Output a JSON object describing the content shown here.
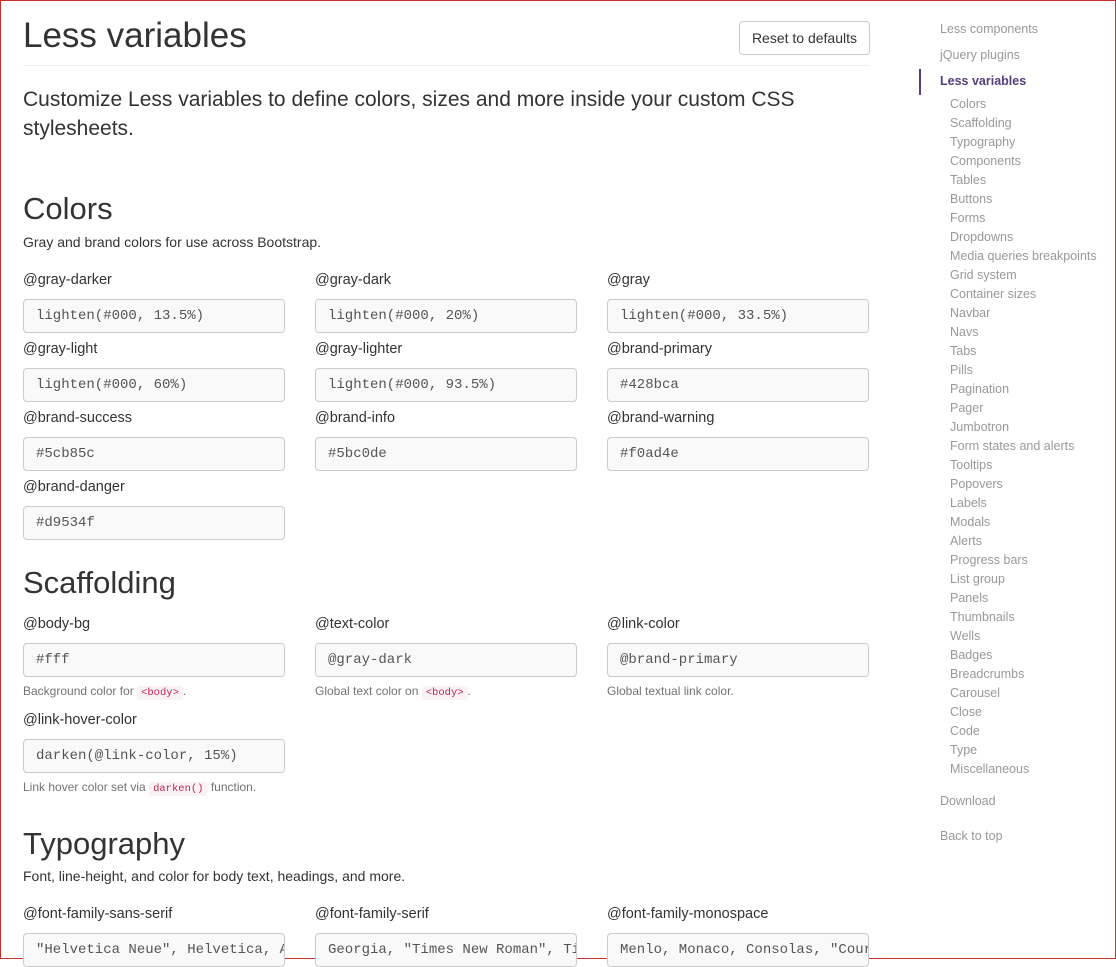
{
  "header": {
    "title": "Less variables",
    "reset_label": "Reset to defaults"
  },
  "lead": "Customize Less variables to define colors, sizes and more inside your custom CSS stylesheets.",
  "colors": {
    "title": "Colors",
    "desc": "Gray and brand colors for use across Bootstrap.",
    "fields": [
      {
        "label": "@gray-darker",
        "value": "lighten(#000, 13.5%)"
      },
      {
        "label": "@gray-dark",
        "value": "lighten(#000, 20%)"
      },
      {
        "label": "@gray",
        "value": "lighten(#000, 33.5%)"
      },
      {
        "label": "@gray-light",
        "value": "lighten(#000, 60%)"
      },
      {
        "label": "@gray-lighter",
        "value": "lighten(#000, 93.5%)"
      },
      {
        "label": "@brand-primary",
        "value": "#428bca"
      },
      {
        "label": "@brand-success",
        "value": "#5cb85c"
      },
      {
        "label": "@brand-info",
        "value": "#5bc0de"
      },
      {
        "label": "@brand-warning",
        "value": "#f0ad4e"
      },
      {
        "label": "@brand-danger",
        "value": "#d9534f"
      }
    ]
  },
  "scaffolding": {
    "title": "Scaffolding",
    "fields": [
      {
        "label": "@body-bg",
        "value": "#fff",
        "help_pre": "Background color for ",
        "help_code": "<body>",
        "help_post": "."
      },
      {
        "label": "@text-color",
        "value": "@gray-dark",
        "help_pre": "Global text color on ",
        "help_code": "<body>",
        "help_post": "."
      },
      {
        "label": "@link-color",
        "value": "@brand-primary",
        "help_pre": "Global textual link color.",
        "help_code": "",
        "help_post": ""
      },
      {
        "label": "@link-hover-color",
        "value": "darken(@link-color, 15%)",
        "help_pre": "Link hover color set via ",
        "help_code": "darken()",
        "help_post": " function."
      }
    ]
  },
  "typography": {
    "title": "Typography",
    "desc": "Font, line-height, and color for body text, headings, and more.",
    "fields": [
      {
        "label": "@font-family-sans-serif",
        "value": "\"Helvetica Neue\", Helvetica, Arial, sans-serif"
      },
      {
        "label": "@font-family-serif",
        "value": "Georgia, \"Times New Roman\", Times, serif"
      },
      {
        "label": "@font-family-monospace",
        "value": "Menlo, Monaco, Consolas, \"Courier New\", monospace"
      }
    ]
  },
  "sidebar": {
    "top": [
      "Less components",
      "jQuery plugins",
      "Less variables"
    ],
    "sub": [
      "Colors",
      "Scaffolding",
      "Typography",
      "Components",
      "Tables",
      "Buttons",
      "Forms",
      "Dropdowns",
      "Media queries breakpoints",
      "Grid system",
      "Container sizes",
      "Navbar",
      "Navs",
      "Tabs",
      "Pills",
      "Pagination",
      "Pager",
      "Jumbotron",
      "Form states and alerts",
      "Tooltips",
      "Popovers",
      "Labels",
      "Modals",
      "Alerts",
      "Progress bars",
      "List group",
      "Panels",
      "Thumbnails",
      "Wells",
      "Badges",
      "Breadcrumbs",
      "Carousel",
      "Close",
      "Code",
      "Type",
      "Miscellaneous"
    ],
    "download": "Download",
    "back_to_top": "Back to top",
    "active_color": "#563d7c"
  }
}
